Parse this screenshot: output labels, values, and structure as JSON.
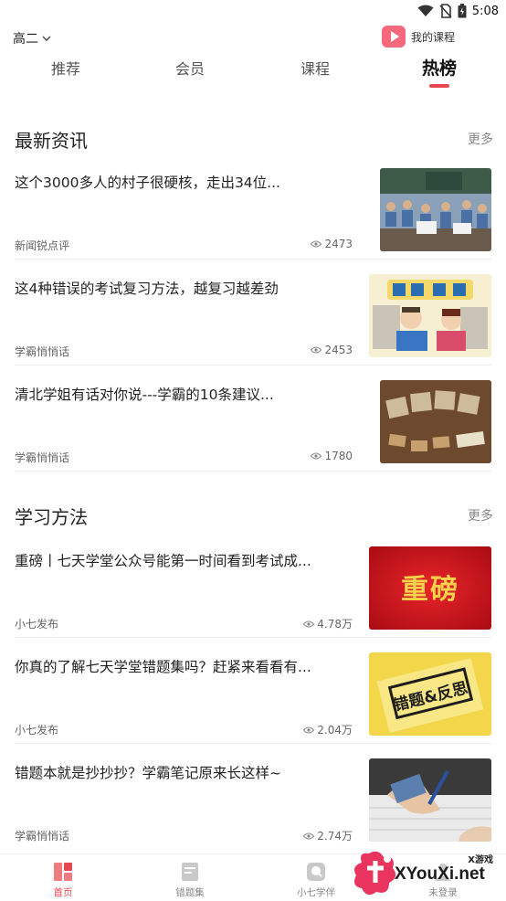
{
  "status_bar": {
    "time": "5:08"
  },
  "header": {
    "grade": "高二",
    "my_courses": "我的课程"
  },
  "tabs": [
    {
      "label": "推荐"
    },
    {
      "label": "会员"
    },
    {
      "label": "课程"
    },
    {
      "label": "热榜"
    }
  ],
  "sections": [
    {
      "title": "最新资讯",
      "more": "更多",
      "articles": [
        {
          "title": "这个3000多人的村子很硬核，走出34位...",
          "source": "新闻锐点评",
          "views": "2473",
          "thumb": "classroom-photo"
        },
        {
          "title": "这4种错误的考试复习方法，越复习越差劲",
          "source": "学霸悄悄话",
          "views": "2453",
          "thumb": "cartoon-students-exam-photo"
        },
        {
          "title": "清北学姐有话对你说---学霸的10条建议...",
          "source": "学霸悄悄话",
          "views": "1780",
          "thumb": "chalkboard-super-scholar-photo"
        }
      ]
    },
    {
      "title": "学习方法",
      "more": "更多",
      "articles": [
        {
          "title": "重磅丨七天学堂公众号能第一时间看到考试成...",
          "source": "小七发布",
          "views": "4.78万",
          "thumb": "red-banner-photo",
          "thumb_text": "重磅"
        },
        {
          "title": "你真的了解七天学堂错题集吗？赶紧来看看有...",
          "source": "小七发布",
          "views": "2.04万",
          "thumb": "yellow-paper-photo",
          "thumb_text": "错题&反思"
        },
        {
          "title": "错题本就是抄抄抄？学霸笔记原来长这样~",
          "source": "学霸悄悄话",
          "views": "2.74万",
          "thumb": "handwriting-photo"
        }
      ]
    }
  ],
  "bottom_nav": [
    {
      "label": "首页",
      "icon": "home-grid-icon",
      "active": true
    },
    {
      "label": "错题集",
      "icon": "notebook-icon",
      "active": false
    },
    {
      "label": "小七学伴",
      "icon": "companion-icon",
      "active": false
    },
    {
      "label": "未登录",
      "icon": "user-icon",
      "active": false
    }
  ],
  "watermark": {
    "text": "XYouXi.net",
    "sub": "X游戏"
  },
  "colors": {
    "accent": "#e9474f",
    "tab_active": "#111111",
    "muted": "#888888"
  }
}
